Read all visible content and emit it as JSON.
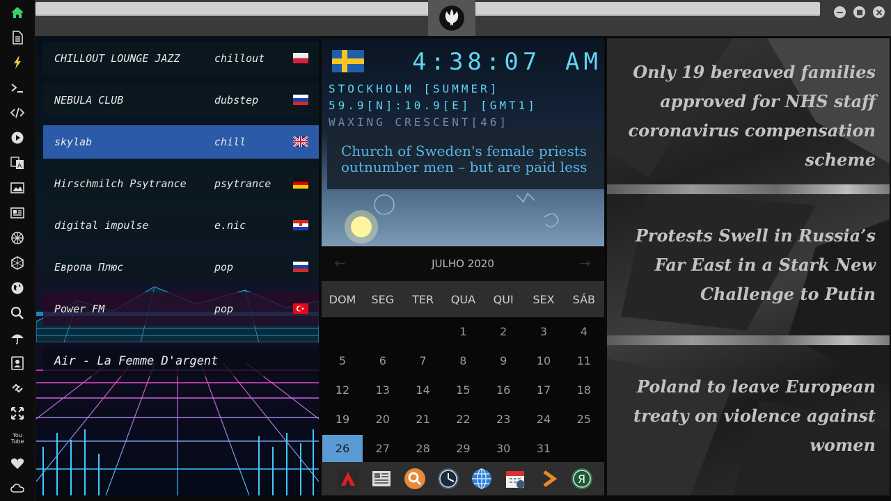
{
  "rail": {
    "icons": [
      "home-icon",
      "document-icon",
      "lightning-icon",
      "terminal-icon",
      "code-icon",
      "play-icon",
      "translate-icon",
      "image-icon",
      "newspaper-icon",
      "settings-wheel-icon",
      "hexagon-icon",
      "globe-icon",
      "search-icon",
      "umbrella-icon",
      "contacts-icon",
      "link-icon",
      "expand-icon",
      "youtube-icon",
      "heart-icon",
      "cloud-icon"
    ],
    "youtube_label": "You Tube",
    "accent": "#3ecf6a"
  },
  "radio": {
    "stations": [
      {
        "name": "CHILLOUT LOUNGE JAZZ",
        "genre": "chillout",
        "flag": "poland"
      },
      {
        "name": "NEBULA CLUB",
        "genre": "dubstep",
        "flag": "russia"
      },
      {
        "name": "skylab",
        "genre": "chill",
        "flag": "uk",
        "selected": true
      },
      {
        "name": "Hirschmilch Psytrance",
        "genre": "psytrance",
        "flag": "germany"
      },
      {
        "name": "digital impulse",
        "genre": "e.nic",
        "flag": "croatia"
      },
      {
        "name": "Европа Плюс",
        "genre": "pop",
        "flag": "russia"
      },
      {
        "name": "Power FM",
        "genre": "pop",
        "flag": "turkey"
      }
    ],
    "now_playing": "Air - La Femme D'argent",
    "selected_color": "#2a5aa8"
  },
  "clock": {
    "time": "4:38:07",
    "ampm": "AM",
    "city": "STOCKHOLM [SUMMER]",
    "coords": "59.9[N]:10.9[E] [GMT1]",
    "moon": "WAXING CRESCENT[46]",
    "flag": "sweden",
    "headline": "Church of Sweden's female priests outnumber men – but are paid less"
  },
  "calendar": {
    "month_title": "JULHO 2020",
    "weekdays": [
      "DOM",
      "SEG",
      "TER",
      "QUA",
      "QUI",
      "SEX",
      "SÁB"
    ],
    "first_weekday_index": 3,
    "days_in_month": 31,
    "today": 26,
    "today_color": "#5a9ad5"
  },
  "dock": {
    "icons": [
      "adobe-reader-icon",
      "news-feed-icon",
      "search-app-icon",
      "clock-app-icon",
      "browser-globe-icon",
      "calendar-app-icon",
      "arrow-app-icon",
      "yandex-icon"
    ]
  },
  "news": {
    "headlines": [
      "Only 19 bereaved families approved for NHS staff coronavirus compensation scheme",
      "Protests Swell in Russia’s Far East in a Stark New Challenge to Putin",
      "Poland to leave European treaty on violence against women"
    ]
  }
}
